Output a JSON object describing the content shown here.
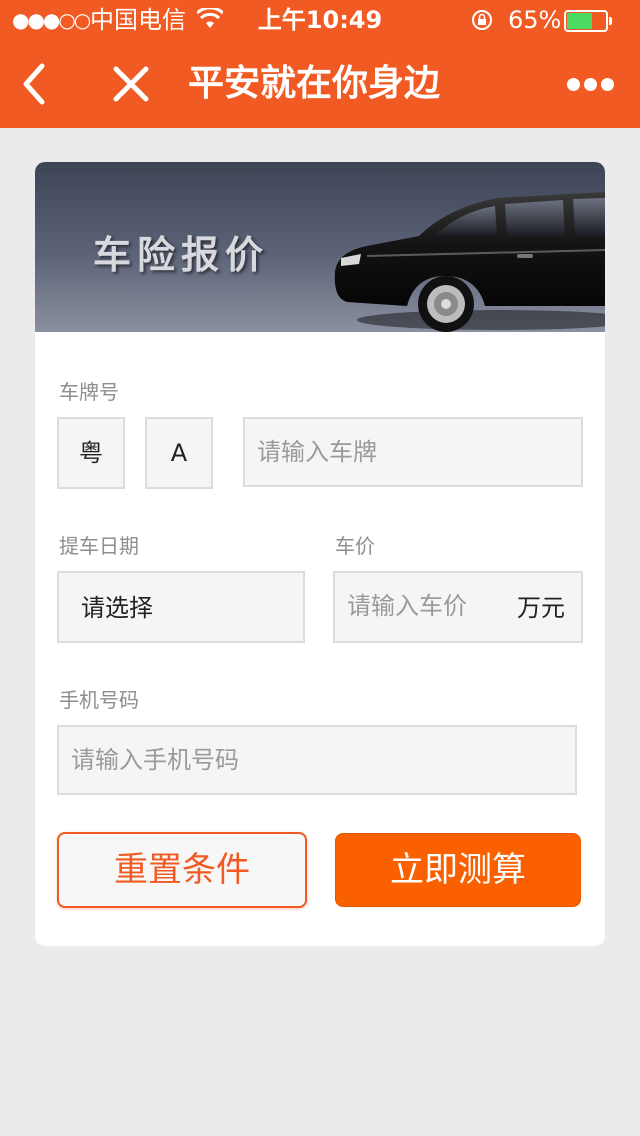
{
  "status_bar": {
    "signal": "●●●○○",
    "carrier": "中国电信",
    "time": "上午10:49",
    "battery_percent": "65%",
    "battery_level": 0.65,
    "battery_color": "#4cd964"
  },
  "nav": {
    "title": "平安就在你身边",
    "back_icon": "chevron-left-icon",
    "close_icon": "close-icon",
    "more_icon": "more-dots-icon"
  },
  "colors": {
    "header": "#f15a22",
    "primary_button": "#fa6000",
    "background": "#ebebeb"
  },
  "banner": {
    "title": "车险报价"
  },
  "form": {
    "plate": {
      "label": "车牌号",
      "province": "粤",
      "letter": "A",
      "placeholder": "请输入车牌"
    },
    "pickup_date": {
      "label": "提车日期",
      "value": "请选择"
    },
    "price": {
      "label": "车价",
      "placeholder": "请输入车价",
      "unit": "万元"
    },
    "phone": {
      "label": "手机号码",
      "placeholder": "请输入手机号码"
    }
  },
  "buttons": {
    "reset": "重置条件",
    "calculate": "立即测算"
  }
}
